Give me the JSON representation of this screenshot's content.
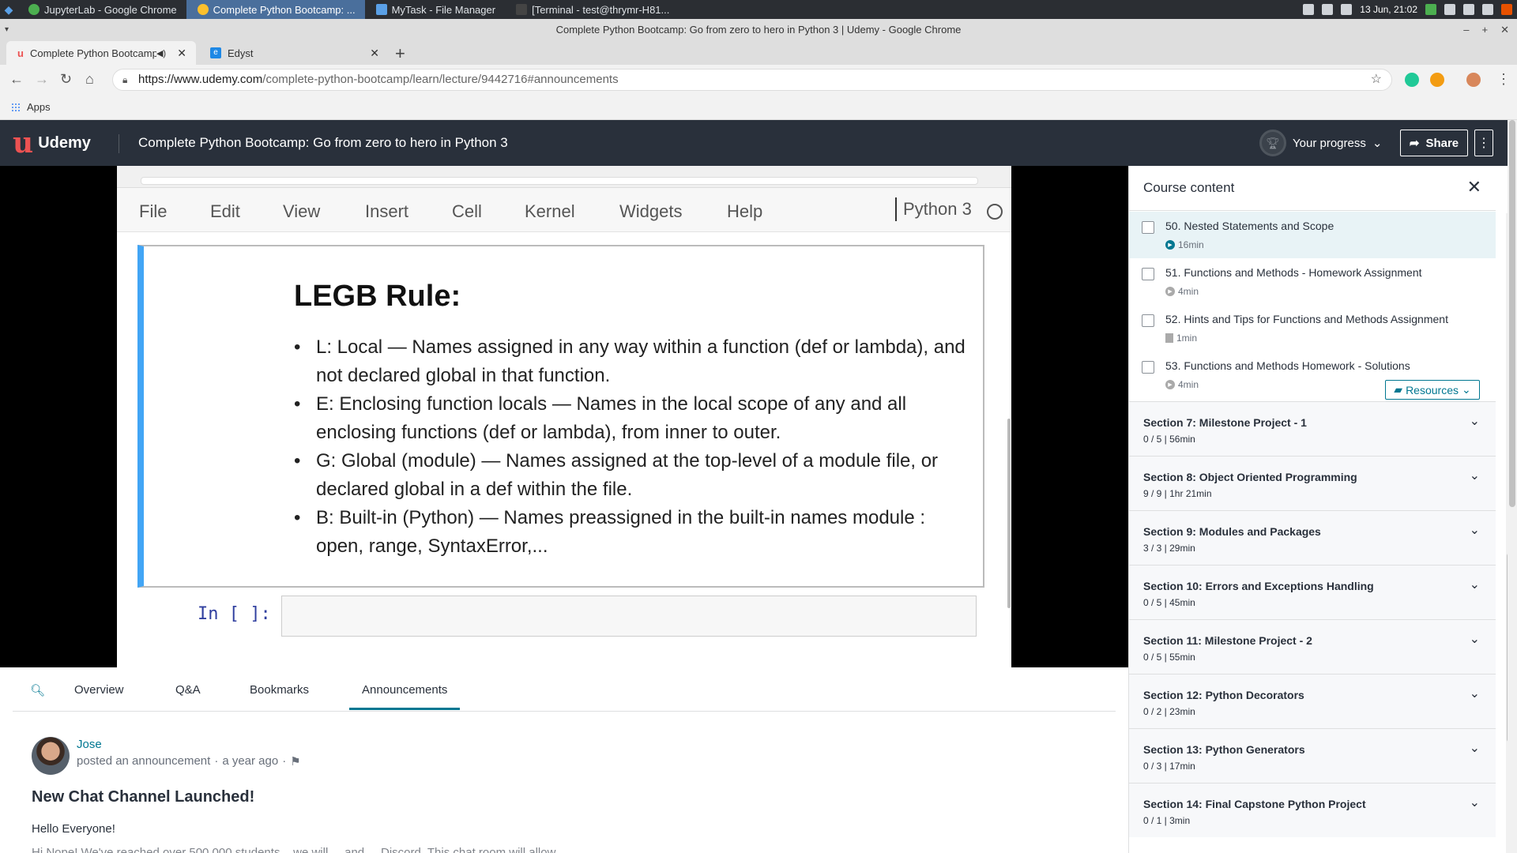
{
  "taskbar": {
    "tasks": [
      {
        "label": "JupyterLab - Google Chrome"
      },
      {
        "label": "Complete Python Bootcamp: ..."
      },
      {
        "label": "MyTask - File Manager"
      },
      {
        "label": "[Terminal - test@thrymr-H81..."
      }
    ],
    "clock": "13 Jun, 21:02"
  },
  "window": {
    "title": "Complete Python Bootcamp: Go from zero to hero in Python 3 | Udemy - Google Chrome"
  },
  "browser": {
    "tabs": [
      {
        "label": "Complete Python Bootcamp"
      },
      {
        "label": "Edyst"
      }
    ],
    "url_host": "https://www.udemy.com",
    "url_path": "/complete-python-bootcamp/learn/lecture/9442716#announcements",
    "bookmarks_apps": "Apps"
  },
  "udemy": {
    "logo": "Udemy",
    "course_title": "Complete Python Bootcamp: Go from zero to hero in Python 3",
    "progress_label": "Your progress",
    "share_label": "Share"
  },
  "video": {
    "jupyter_menu": [
      "File",
      "Edit",
      "View",
      "Insert",
      "Cell",
      "Kernel",
      "Widgets",
      "Help"
    ],
    "kernel": "Python 3",
    "slide_title": "LEGB Rule:",
    "bullets": [
      "L: Local — Names assigned in any way within a function (def or lambda), and not declared global in that function.",
      "E: Enclosing function locals — Names in the local scope of any and all enclosing functions (def or lambda), from inner to outer.",
      "G: Global (module) — Names assigned at the top-level of a module file, or declared global in a def within the file.",
      "B: Built-in (Python) — Names preassigned in the built-in names module : open, range, SyntaxError,..."
    ],
    "in_prompt": "In [ ]:"
  },
  "lecture_nav": {
    "tabs": [
      "Overview",
      "Q&A",
      "Bookmarks",
      "Announcements"
    ]
  },
  "announcement": {
    "author": "Jose",
    "action": "posted an announcement",
    "time": "a year ago",
    "title": "New Chat Channel Launched!",
    "greeting": "Hello Everyone!",
    "faded_line": "Hi Nope! We've reached over 500,000 students... we will ... and ... Discord. This chat room will allow ..."
  },
  "sidebar": {
    "title": "Course content",
    "lectures": [
      {
        "title": "50. Nested Statements and Scope",
        "duration": "16min",
        "kind": "video"
      },
      {
        "title": "51. Functions and Methods - Homework Assignment",
        "duration": "4min",
        "kind": "video"
      },
      {
        "title": "52. Hints and Tips for Functions and Methods Assignment",
        "duration": "1min",
        "kind": "doc"
      },
      {
        "title": "53. Functions and Methods Homework - Solutions",
        "duration": "4min",
        "kind": "video"
      }
    ],
    "resources_label": "Resources",
    "sections": [
      {
        "title": "Section 7: Milestone Project - 1",
        "meta": "0 / 5  |  56min"
      },
      {
        "title": "Section 8: Object Oriented Programming",
        "meta": "9 / 9  |  1hr 21min"
      },
      {
        "title": "Section 9: Modules and Packages",
        "meta": "3 / 3  |  29min"
      },
      {
        "title": "Section 10: Errors and Exceptions Handling",
        "meta": "0 / 5  |  45min"
      },
      {
        "title": "Section 11: Milestone Project - 2",
        "meta": "0 / 5  |  55min"
      },
      {
        "title": "Section 12: Python Decorators",
        "meta": "0 / 2  |  23min"
      },
      {
        "title": "Section 13: Python Generators",
        "meta": "0 / 3  |  17min"
      },
      {
        "title": "Section 14: Final Capstone Python Project",
        "meta": "0 / 1  |  3min"
      }
    ]
  },
  "colors": {
    "udemy_red": "#ec5252",
    "header_bg": "#29303b",
    "teal": "#007791",
    "jupyter_blue": "#42a5f5"
  }
}
